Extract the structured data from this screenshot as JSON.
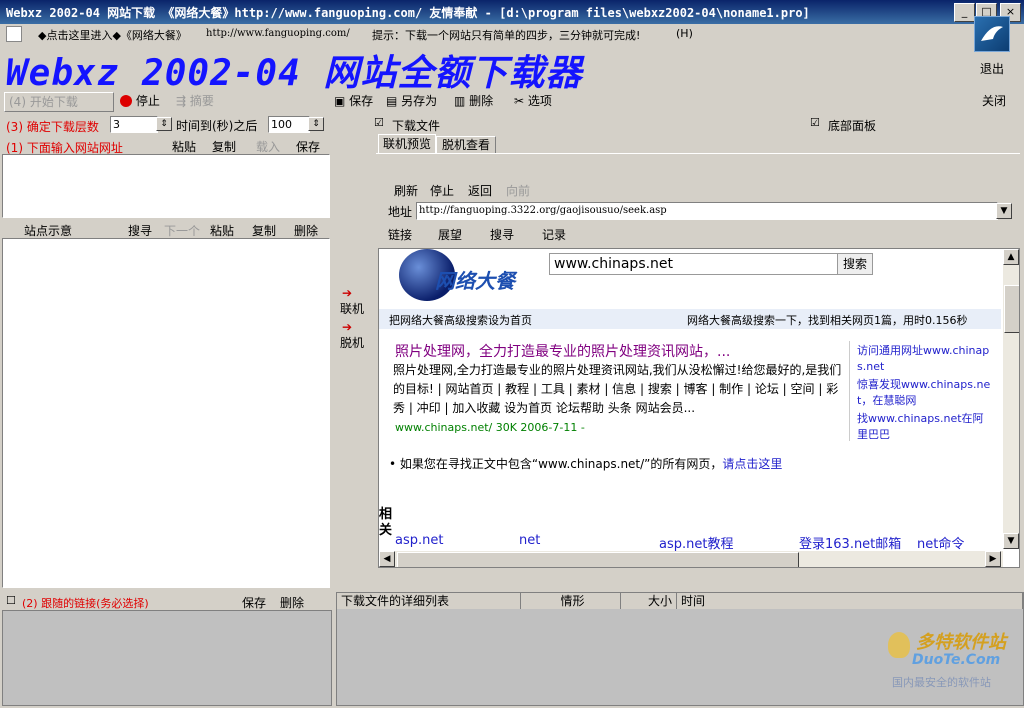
{
  "window": {
    "title": "Webxz 2002-04 网站下载 《网络大餐》http://www.fanguoping.com/ 友情奉献 - [d:\\program files\\webxz2002-04\\noname1.pro]",
    "minimize": "_",
    "maximize": "□",
    "close": "×"
  },
  "info": {
    "link_text": "◆点击这里进入◆《网络大餐》",
    "url": "http://www.fanguoping.com/",
    "tip": "提示：下载一个网站只有简单的四步，三分钟就可完成!",
    "help": "(H)"
  },
  "app_title": "Webxz 2002-04 网站全额下载器",
  "exit_label": "退出",
  "toolbar": {
    "start": "(4) 开始下载",
    "stop": "停止",
    "summary": "摘要",
    "save": "保存",
    "save_as": "另存为",
    "delete": "删除",
    "options": "选项",
    "close": "关闭"
  },
  "left": {
    "depth_label": "(3) 确定下载层数",
    "depth_value": "3",
    "time_label": "时间到(秒)之后",
    "time_value": "100",
    "url_label": "(1) 下面输入网站网址",
    "paste": "粘贴",
    "copy": "复制",
    "load": "载入",
    "save": "保存",
    "sites_label": "站点示意",
    "search": "搜寻",
    "next": "下一个",
    "paste2": "粘贴",
    "copy2": "复制",
    "delete2": "删除"
  },
  "middle": {
    "online": "联机",
    "offline": "脱机"
  },
  "right": {
    "download_file": "下载文件",
    "bottom_panel": "底部面板",
    "tab_preview": "联机预览",
    "tab_offline": "脱机查看",
    "refresh": "刷新",
    "stop": "停止",
    "back": "返回",
    "forward": "向前",
    "address_label": "地址",
    "address_value": "http://fanguoping.3322.org/gaojisousuo/seek.asp",
    "links": "链接",
    "outlook": "展望",
    "search": "搜寻",
    "record": "记录"
  },
  "page": {
    "logo_text": "网络大餐",
    "search_value": "www.chinaps.net",
    "search_button": "搜索",
    "set_home": "把网络大餐高级搜索设为首页",
    "result_summary": "网络大餐高级搜索一下，找到相关网页1篇，用时0.156秒",
    "result_title": "照片处理网，全力打造最专业的照片处理资讯网站，...",
    "result_desc": "照片处理网,全力打造最专业的照片处理资讯网站,我们从没松懈过!给您最好的,是我们的目标! | 网站首页 | 教程 | 工具 | 素材 | 信息 | 搜索 | 博客 | 制作 | 论坛 | 空间 | 彩秀 | 冲印 | 加入收藏 设为首页 论坛帮助 头条 网站会员...",
    "result_url": "www.chinaps.net/ 30K 2006-7-11 -",
    "side1": "访问通用网址www.chinaps.net",
    "side2": "惊喜发现www.chinaps.net，在慧聪网",
    "side3": "找www.chinaps.net在阿里巴巴",
    "more_prefix": "• 如果您在寻找正文中包含“www.chinaps.net/”的所有网页，",
    "more_link": "请点击这里",
    "related_label": "相关",
    "related": [
      "asp.net",
      "net",
      "asp.net教程",
      "登录163.net邮箱",
      "net命令"
    ]
  },
  "bottom": {
    "follow_label": "(2) 跟随的链接(务必选择)",
    "save": "保存",
    "delete": "删除",
    "col_list": "下载文件的详细列表",
    "col_status": "情形",
    "col_size": "大小",
    "col_time": "时间"
  },
  "watermark": {
    "brand": "多特软件站",
    "domain": "DuoTe.Com",
    "slogan": "国内最安全的软件站"
  },
  "colors": {
    "accent_blue": "#1414ff",
    "label_red": "#e00000",
    "link_blue": "#2222cc"
  }
}
